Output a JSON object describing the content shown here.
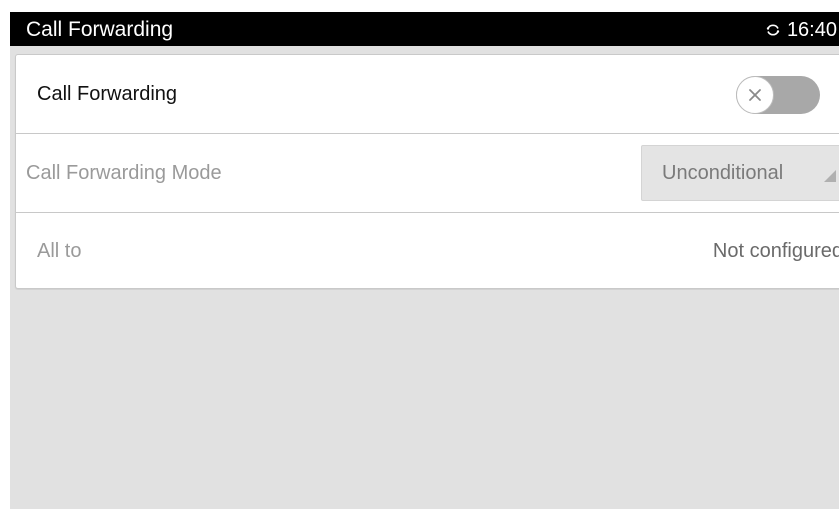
{
  "status_bar": {
    "title": "Call Forwarding",
    "time": "16:40",
    "sync_icon": "sync-icon"
  },
  "settings": {
    "call_forwarding": {
      "label": "Call Forwarding",
      "toggle_state": "off",
      "toggle_icon": "close-icon"
    },
    "mode": {
      "label": "Call Forwarding Mode",
      "selected": "Unconditional",
      "dropdown_icon": "dropdown-corner-icon"
    },
    "all_to": {
      "label": "All to",
      "value": "Not configured"
    }
  },
  "colors": {
    "status_bar_bg": "#000000",
    "screen_bg": "#e1e1e1",
    "card_bg": "#ffffff",
    "toggle_off": "#a8a8a8",
    "muted_text": "#9a9a9a",
    "select_bg": "#e4e4e4"
  }
}
